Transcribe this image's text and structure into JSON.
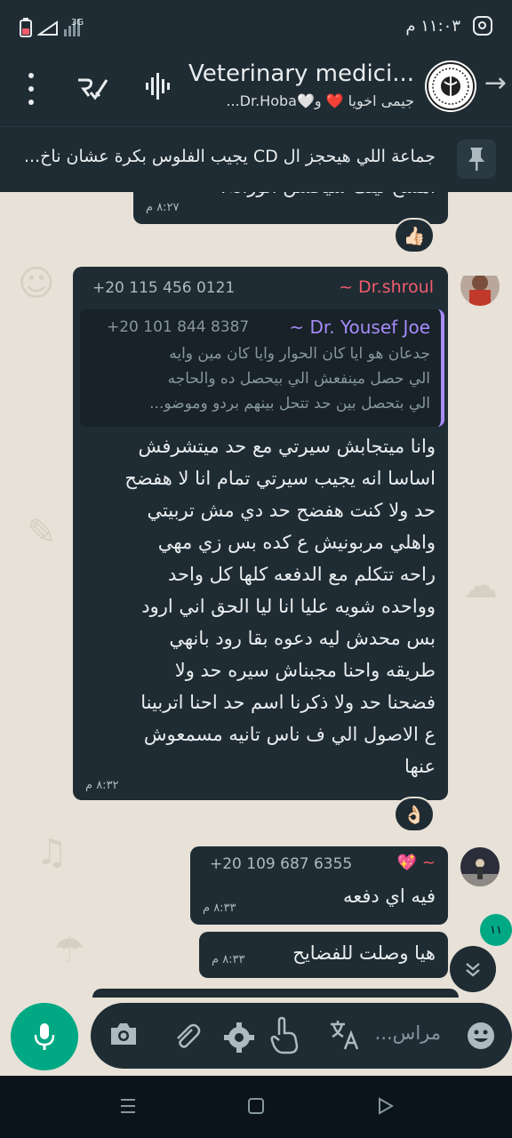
{
  "status_bar": {
    "time": "١١:٠٣ م",
    "network": "3G",
    "icons": [
      "battery-icon",
      "signal-icon",
      "instagram-icon"
    ]
  },
  "header": {
    "title": "Veterinary medici...",
    "subtitle": "جيمى اخويا ❤️ و🤍Dr.Hoba..."
  },
  "pinned": {
    "text": "جماعة اللي هيحجز ال CD يجيب الفلوس بكرة عشان ناخ..."
  },
  "messages": [
    {
      "partial_text": "امسح لينك سيحسن الوراثة!",
      "time": "٨:٢٧ م",
      "reaction": "👍🏻"
    },
    {
      "sender_name": "~ Dr.shroul",
      "sender_phone": "+20 115 456 0121",
      "quote": {
        "name": "~ Dr. Yousef Joe",
        "phone": "+20 101 844 8387",
        "lines": [
          "جدعان هو ايا كان الحوار وايا كان مين وايه",
          "الي حصل مينفعش الي بيحصل ده والحاجه",
          "الي بتحصل بين حد تتحل بينهم بردو وموضو..."
        ]
      },
      "lines": [
        "وانا ميتجابش سيرتي مع حد ميتشرفش",
        "اساسا انه يجيب سيرتي تمام انا لا هفضح",
        "حد ولا كنت هفضح حد دي مش تربيتي",
        "واهلي مربونيش ع كده بس زي مهي",
        "راحه تتكلم مع الدفعه كلها كل واحد",
        "وواحده شويه عليا انا ليا الحق اني ارود",
        "بس محدش ليه دعوه بقا رود بانهي",
        "طريقه واحنا مجبناش سيره حد ولا",
        "فضحنا حد ولا ذكرنا اسم حد احنا اتربينا",
        "ع الاصول الي ف ناس تانيه مسمعوش",
        "عنها"
      ],
      "time": "٨:٣٢ م",
      "reaction": "👌🏻"
    },
    {
      "sender_name": "💖 ~",
      "sender_phone": "+20 109 687 6355",
      "text": "فيه اي دفعه",
      "time": "٨:٣٣ م"
    },
    {
      "text": "هيا وصلت للفضايح",
      "time": "٨:٣٣ م"
    }
  ],
  "unread_badge": "١١",
  "input": {
    "placeholder": "مراس..."
  },
  "colors": {
    "accent": "#00a884",
    "bubble": "#1f2c33",
    "quote_accent": "#a78bfa",
    "sender_name": "#f15c6d"
  }
}
